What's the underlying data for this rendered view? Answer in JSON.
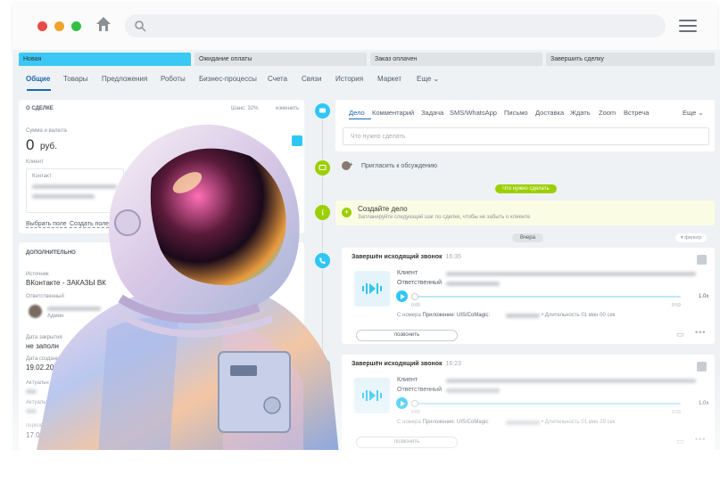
{
  "browser": {
    "icons": [
      "home-icon",
      "search-icon",
      "menu-icon"
    ],
    "traffic_colors": [
      "#ea4a45",
      "#f2a12d",
      "#33c145"
    ]
  },
  "stages": [
    {
      "label": "Новая",
      "color": "#3bc8f5"
    },
    {
      "label": "Ожидание оплаты",
      "color": "#dfe3e6"
    },
    {
      "label": "Заказ оплачен",
      "color": "#dfe3e6"
    },
    {
      "label": "Завершить сделку",
      "color": "#dfe3e6"
    }
  ],
  "tabs": [
    "Общие",
    "Товары",
    "Предложения",
    "Роботы",
    "Бизнес-процессы",
    "Счета",
    "Связи",
    "История",
    "Маркет",
    "Еще"
  ],
  "deal": {
    "header": "О СДЕЛКЕ",
    "success": "Шанс: 32%",
    "edit": "изменить",
    "sum_label": "Сумма и валюта",
    "sum_value": "0",
    "currency": "руб.",
    "client_label": "Клиент",
    "contact_label": "Контакт",
    "select_field": "Выбрать поле",
    "create_field": "Создать поле"
  },
  "additional": {
    "header": "ДОПОЛНИТЕЛЬНО",
    "source_label": "Источник",
    "source_value": "ВКонтакте - ЗАКАЗЫ ВК",
    "responsible_label": "Ответственный",
    "responsible_role": "Админ",
    "close_label": "Дата закрытия",
    "close_value": "не заполн",
    "created_label": "Дата создания",
    "created_value": "19.02.20",
    "actual1_label": "Актуальн",
    "actual2_label": "Актуальн",
    "last_label": "перезв",
    "last_value": "17.0"
  },
  "activity": {
    "tabs": [
      "Дело",
      "Комментарий",
      "Задача",
      "SMS/WhatsApp",
      "Письмо",
      "Доставка",
      "Ждать",
      "Zoom",
      "Встреча"
    ],
    "more": "Еще",
    "placeholder": "Что нужно сделать",
    "invite": "Пригласить к обсуждению",
    "todo_pill": "Что нужно сделать",
    "create_title": "Создайте дело",
    "create_sub": "Запланируйте следующий шаг по сделке, чтобы не забыть о клиенте",
    "yesterday": "Вчера",
    "filter": "фильтр"
  },
  "calls": [
    {
      "title": "Завершён исходящий звонок",
      "time": "16:35",
      "client_label": "Клиент",
      "responsible_label": "Ответственный",
      "t_start": "0:00",
      "t_end": "0:59",
      "speed": "1.0x",
      "from_label": "С номера",
      "app_label": "Приложение: UIS/CoMagic:",
      "duration": "• Длительность 01 мин 00 сек",
      "button": "позвонить"
    },
    {
      "title": "Завершён исходящий звонок",
      "time": "16:23",
      "client_label": "Клиент",
      "responsible_label": "Ответственный",
      "t_start": "0:00",
      "t_end": "0:29",
      "speed": "1.0x",
      "from_label": "С номера",
      "app_label": "Приложение: UIS/CoMagic:",
      "duration": "• Длительность 01 мин 29 сек",
      "button": "позвонить"
    }
  ],
  "accent": "#2067b0",
  "timeline_icons": [
    {
      "name": "chat-icon",
      "color": "#2fc6f6"
    },
    {
      "name": "comment-icon",
      "color": "#9dcf00"
    },
    {
      "name": "info-icon",
      "color": "#9dcf00"
    },
    {
      "name": "phone-icon",
      "color": "#2fc6f6"
    },
    {
      "name": "phone-icon",
      "color": "#2fc6f6"
    }
  ]
}
